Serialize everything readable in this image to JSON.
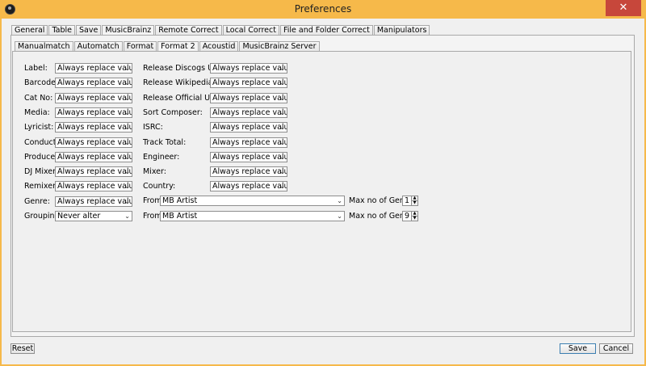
{
  "window": {
    "title": "Preferences",
    "close_glyph": "✕"
  },
  "top_tabs": [
    "General",
    "Table",
    "Save",
    "MusicBrainz",
    "Remote Correct",
    "Local Correct",
    "File and Folder Correct",
    "Manipulators"
  ],
  "sub_tabs": [
    "Manualmatch",
    "Automatch",
    "Format",
    "Format 2",
    "Acoustid",
    "MusicBrainz Server"
  ],
  "left_fields": [
    {
      "label": "Label:",
      "value": "Always replace values"
    },
    {
      "label": "Barcode:",
      "value": "Always replace values"
    },
    {
      "label": "Cat No:",
      "value": "Always replace values"
    },
    {
      "label": "Media:",
      "value": "Always replace values"
    },
    {
      "label": "Lyricist:",
      "value": "Always replace values"
    },
    {
      "label": "Conductor:",
      "value": "Always replace values"
    },
    {
      "label": "Producer:",
      "value": "Always replace values"
    },
    {
      "label": "DJ Mixer:",
      "value": "Always replace values"
    },
    {
      "label": "Remixer:",
      "value": "Always replace values"
    },
    {
      "label": "Genre:",
      "value": "Always replace values"
    },
    {
      "label": "Grouping:",
      "value": "Never alter"
    }
  ],
  "right_fields": [
    {
      "label": "Release Discogs Url:",
      "value": "Always replace values"
    },
    {
      "label": "Release Wikipedia Url:",
      "value": "Always replace values"
    },
    {
      "label": "Release Official Url:",
      "value": "Always replace values"
    },
    {
      "label": "Sort Composer:",
      "value": "Always replace values"
    },
    {
      "label": "ISRC:",
      "value": "Always replace values"
    },
    {
      "label": "Track Total:",
      "value": "Always replace values"
    },
    {
      "label": "Engineer:",
      "value": "Always replace values"
    },
    {
      "label": "Mixer:",
      "value": "Always replace values"
    },
    {
      "label": "Country:",
      "value": "Always replace values"
    }
  ],
  "genre_row": {
    "from_label": "From",
    "source": "MB Artist",
    "max_label": "Max no of Genres",
    "max_value": "1"
  },
  "grouping_row": {
    "from_label": "From",
    "source": "MB Artist",
    "max_label": "Max no of Genres",
    "max_value": "9"
  },
  "buttons": {
    "reset": "Reset",
    "save": "Save",
    "cancel": "Cancel"
  },
  "icons": {
    "app": "app-icon",
    "dropdown": "chevron-down-icon",
    "spinner_up": "▲",
    "spinner_down": "▼",
    "dropdown_glyph": "⌄"
  },
  "colors": {
    "titlebar": "#f6b94a",
    "close": "#c7473b",
    "default_button_border": "#3c7fb1"
  }
}
